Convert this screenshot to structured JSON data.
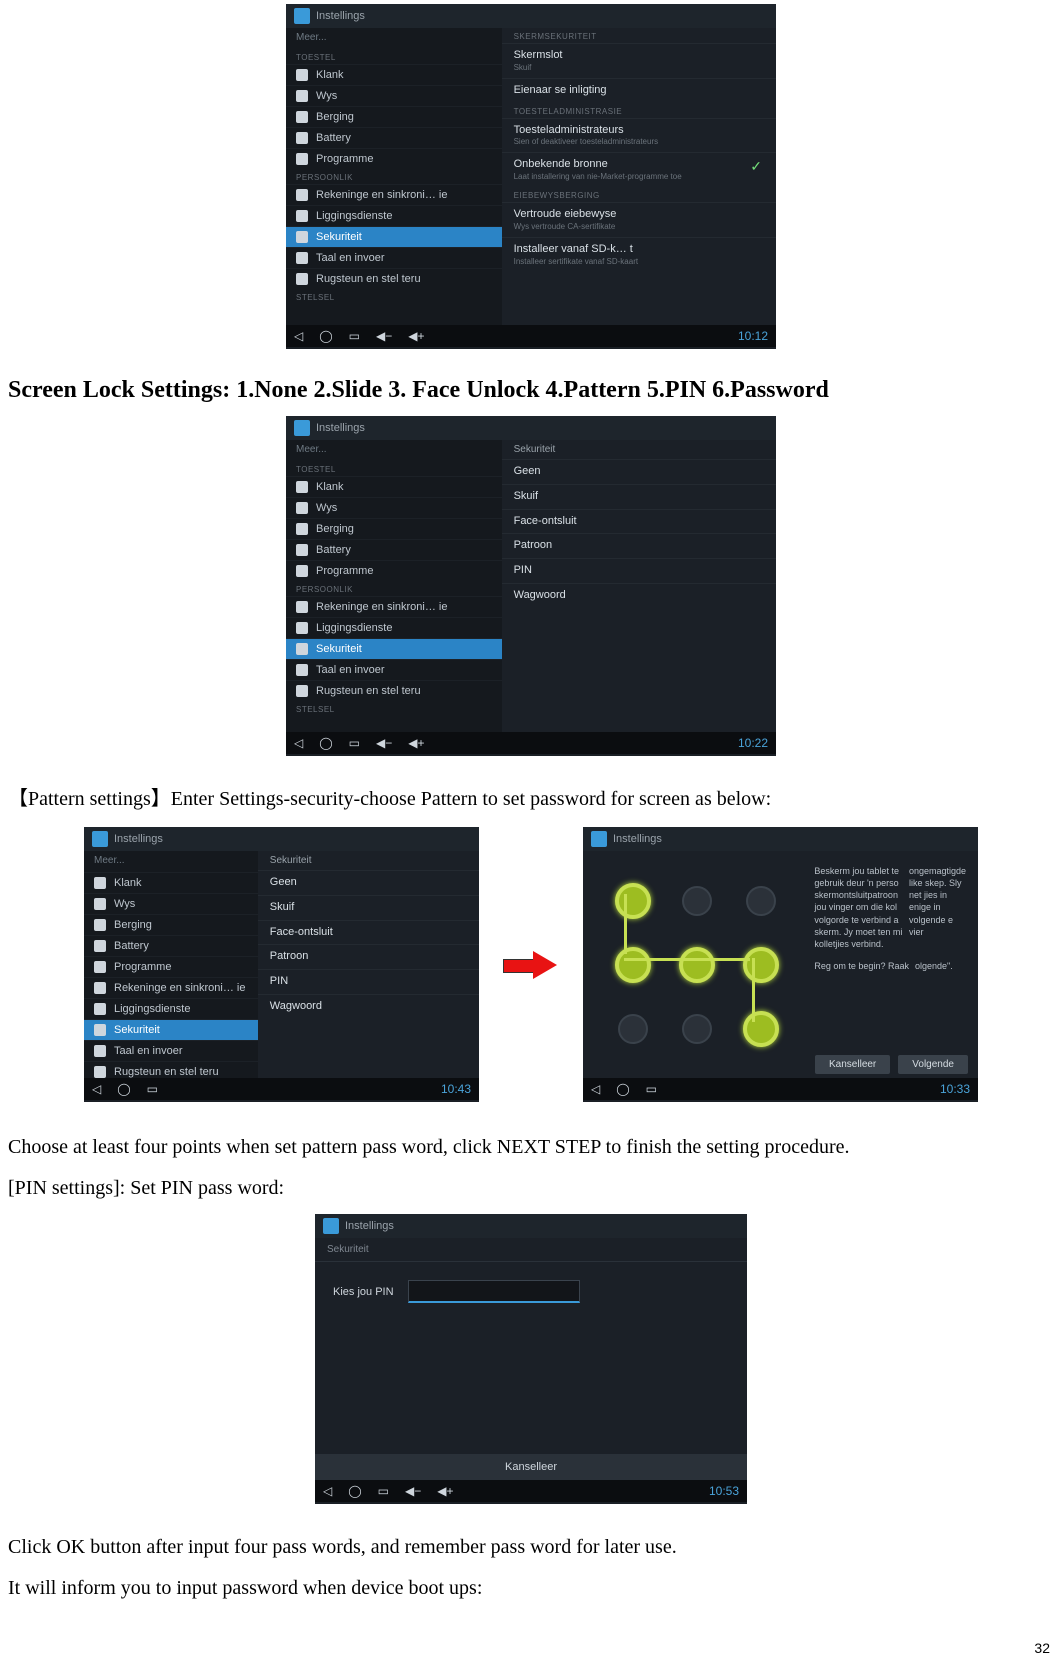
{
  "page_number": "32",
  "heading1": "Screen Lock Settings: 1.None 2.Slide 3. Face Unlock 4.Pattern 5.PIN 6.Password",
  "para_pattern_intro": "【Pattern settings】Enter Settings-security-choose Pattern to set password for screen as below:",
  "para_choose": "Choose at least four points when set pattern pass word, click NEXT STEP to finish the setting procedure.",
  "para_pin_heading": "[PIN settings]: Set PIN pass word:",
  "para_click_ok": "Click OK button after input four pass words, and remember pass word for later use.",
  "para_inform": "It will inform you to input password when device boot ups:",
  "app_title": "Instellings",
  "shot1": {
    "left_more": "Meer...",
    "left_cat1": "TOESTEL",
    "left_items": [
      "Klank",
      "Wys",
      "Berging",
      "Battery",
      "Programme"
    ],
    "left_cat2": "PERSOONLIK",
    "left_items2": [
      "Rekeninge en sinkroni…  ie",
      "Liggingsdienste",
      "Sekuriteit",
      "Taal en invoer",
      "Rugsteun en stel teru"
    ],
    "left_cat3": "STELSEL",
    "right_hdr": "SKERMSEKURITEIT",
    "right_items": [
      {
        "t": "Skermslot",
        "s": "Skuif"
      },
      {
        "t": "Eienaar se inligting",
        "s": ""
      }
    ],
    "right_cat2": "TOESTELADMINISTRASIE",
    "right_items2": [
      {
        "t": "Toesteladministrateurs",
        "s": "Sien of deaktiveer toesteladministrateurs"
      },
      {
        "t": "Onbekende bronne",
        "s": "Laat installering van nie-Market-programme toe"
      }
    ],
    "right_cat3": "EIEBEWYSBERGING",
    "right_items3": [
      {
        "t": "Vertroude eiebewyse",
        "s": "Wys vertroude CA-sertifikate"
      },
      {
        "t": "Installeer vanaf SD-k…  t",
        "s": "Installeer sertifikate vanaf SD-kaart"
      }
    ],
    "clock": "10:12"
  },
  "shot2": {
    "right_hdr": "Sekuriteit",
    "right_items": [
      "Geen",
      "Skuif",
      "Face-ontsluit",
      "Patroon",
      "PIN",
      "Wagwoord"
    ],
    "clock": "10:22"
  },
  "shot3": {
    "clock": "10:43"
  },
  "shot4": {
    "ptext1": "Beskerm jou tablet te gebruik deur 'n perso skermontsluitpatroon jou vinger om die kol volgorde te verbind a skerm. Jy moet ten mi kolletjies verbind.",
    "ptext2": "Reg om te begin? Raak",
    "ptext_right": "ongemagtigde like skep. Sly net jies in enige in volgende e vier",
    "ptext_right2": "olgende\".",
    "btn_cancel": "Kanselleer",
    "btn_next": "Volgende",
    "clock": "10:33"
  },
  "shot5": {
    "crumb": "Sekuriteit",
    "label": "Kies jou PIN",
    "okbtn": "Kanselleer",
    "clock": "10:53"
  }
}
